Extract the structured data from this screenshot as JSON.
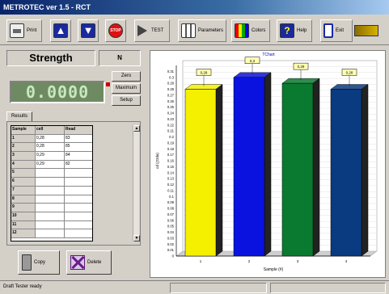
{
  "window": {
    "title": "METROTEC ver 1.5 - RCT"
  },
  "toolbar": {
    "buttons": [
      {
        "label": "Print",
        "icon": "printer-icon"
      },
      {
        "label": "",
        "icon": "up-arrow-icon"
      },
      {
        "label": "",
        "icon": "down-arrow-icon"
      },
      {
        "label": "STOP",
        "icon": "stop-icon"
      },
      {
        "label": "TEST",
        "icon": "play-icon"
      },
      {
        "label": "Parameters",
        "icon": "parameters-icon"
      },
      {
        "label": "Colors",
        "icon": "colors-icon"
      },
      {
        "label": "Help",
        "icon": "help-icon"
      },
      {
        "label": "Exit",
        "icon": "exit-icon"
      }
    ]
  },
  "measurement": {
    "title": "Strength",
    "unit": "N",
    "display_value": "0.0000",
    "buttons": {
      "zero": "Zero",
      "maximum": "Maximum",
      "setup": "Setup"
    }
  },
  "results": {
    "tab_label": "Results",
    "columns": [
      "Sample",
      "cell",
      "Read"
    ],
    "rows": [
      [
        "1",
        "0,28",
        "83"
      ],
      [
        "2",
        "0,28",
        "85"
      ],
      [
        "3",
        "0,29",
        "84"
      ],
      [
        "4",
        "0,29",
        "82"
      ],
      [
        "5",
        "",
        ""
      ],
      [
        "6",
        "",
        ""
      ],
      [
        "7",
        "",
        ""
      ],
      [
        "8",
        "",
        ""
      ],
      [
        "9",
        "",
        ""
      ],
      [
        "10",
        "",
        ""
      ],
      [
        "11",
        "",
        ""
      ],
      [
        "12",
        "",
        ""
      ]
    ],
    "copy_label": "Copy",
    "delete_label": "Delete"
  },
  "chart_data": {
    "type": "bar",
    "title": "TChart",
    "xlabel": "Sample (#)",
    "ylabel": "cd (ƒDda)",
    "categories": [
      "1",
      "2",
      "3",
      "4"
    ],
    "values": [
      0.28,
      0.3,
      0.29,
      0.28
    ],
    "value_labels": [
      "0,28",
      "0,3",
      "0,29",
      "0,28"
    ],
    "ylim": [
      0,
      0.32
    ],
    "yticks": [
      "0",
      "0.01",
      "0.02",
      "0.03",
      "0.04",
      "0.05",
      "0.06",
      "0.07",
      "0.08",
      "0.09",
      "0.1",
      "0.11",
      "0.12",
      "0.13",
      "0.14",
      "0.15",
      "0.16",
      "0.17",
      "0.18",
      "0.19",
      "0.2",
      "0.21",
      "0.22",
      "0.23",
      "0.24",
      "0.25",
      "0.26",
      "0.27",
      "0.28",
      "0.29",
      "0.3",
      "0.31"
    ],
    "colors": [
      "#f4f000",
      "#0a12e0",
      "#0a7a30",
      "#0a3a80"
    ],
    "grid": true
  },
  "status": {
    "text": "Draft Tester ready"
  }
}
